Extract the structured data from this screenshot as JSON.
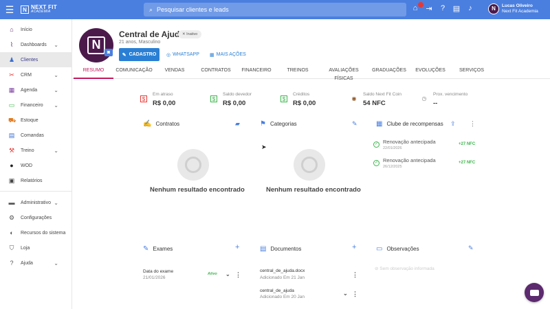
{
  "brand": {
    "name": "NEXT FIT",
    "sub": "ACADEMIA",
    "mark": "N"
  },
  "search": {
    "placeholder": "Pesquisar clientes e leads"
  },
  "user": {
    "name": "Lucas Oliveiro",
    "org": "Next Fit Academia",
    "initial": "N"
  },
  "sidebar": {
    "items": [
      {
        "label": "Início",
        "icon": "home-icon"
      },
      {
        "label": "Dashboards",
        "icon": "chart-icon",
        "chevron": true
      },
      {
        "label": "Clientes",
        "icon": "people-icon",
        "active": true
      },
      {
        "label": "CRM",
        "icon": "crm-icon",
        "chevron": true
      },
      {
        "label": "Agenda",
        "icon": "calendar-icon",
        "chevron": true
      },
      {
        "label": "Financeiro",
        "icon": "money-icon",
        "chevron": true
      },
      {
        "label": "Estoque",
        "icon": "cart-icon"
      },
      {
        "label": "Comandas",
        "icon": "receipt-icon"
      },
      {
        "label": "Treino",
        "icon": "dumbbell-icon",
        "chevron": true
      },
      {
        "label": "WOD",
        "icon": "kettlebell-icon"
      },
      {
        "label": "Relatórios",
        "icon": "report-icon"
      },
      {
        "label": "Administrativo",
        "icon": "admin-icon",
        "chevron": true
      },
      {
        "label": "Configurações",
        "icon": "gear-icon"
      },
      {
        "label": "Recursos do sistema",
        "icon": "toggle-icon"
      },
      {
        "label": "Loja",
        "icon": "store-icon"
      },
      {
        "label": "Ajuda",
        "icon": "help-icon",
        "chevron": true
      }
    ]
  },
  "profile": {
    "name": "Central de Ajuda",
    "status": "Inativo",
    "sub": "21 anos, Masculino",
    "avatar": "N",
    "cadastro": "CADASTRO",
    "whatsapp": "WHATSAPP",
    "mais": "MAIS AÇÕES"
  },
  "tabs": [
    "RESUMO",
    "COMUNICAÇÃO",
    "VENDAS",
    "CONTRATOS",
    "FINANCEIRO",
    "TREINOS",
    "AVALIAÇÕES FÍSICAS",
    "GRADUAÇÕES",
    "EVOLUÇÕES",
    "SERVIÇOS"
  ],
  "stats": [
    {
      "label": "Em atraso",
      "value": "R$ 0,00",
      "color": "#e53935"
    },
    {
      "label": "Saldo devedor",
      "value": "R$ 0,00",
      "color": "#3bb54a"
    },
    {
      "label": "Créditos",
      "value": "R$ 0,00",
      "color": "#3bb54a"
    },
    {
      "label": "Saldo Next Fit Coin",
      "value": "54 NFC",
      "color": "#8d5524"
    },
    {
      "label": "Prox. vencimento",
      "value": "--",
      "color": "#888"
    }
  ],
  "cards": {
    "contratos": "Contratos",
    "categorias": "Categorias",
    "clube": "Clube de recompensas",
    "empty": "Nenhum resultado encontrado",
    "exames": "Exames",
    "documentos": "Documentos",
    "observacoes": "Observações",
    "obs_empty": "Sem observação informada"
  },
  "clube": [
    {
      "title": "Renovação antecipada",
      "date": "22/01/2026",
      "value": "+27 NFC"
    },
    {
      "title": "Renovação antecipada",
      "date": "26/12/2025",
      "value": "+27 NFC"
    }
  ],
  "exame": {
    "label": "Data do exame",
    "date": "21/01/2026",
    "status": "Ativo"
  },
  "documentos": [
    {
      "name": "central_de_ajuda.docx",
      "added": "Adicionado Em 21 Jan"
    },
    {
      "name": "central_de_ajuda",
      "added": "Adicionado Em 20 Jan"
    }
  ],
  "colors": {
    "accent": "#4a7fe0",
    "brand": "#4b1a4b",
    "active_tab": "#c2185b",
    "positive": "#3bb54a"
  }
}
